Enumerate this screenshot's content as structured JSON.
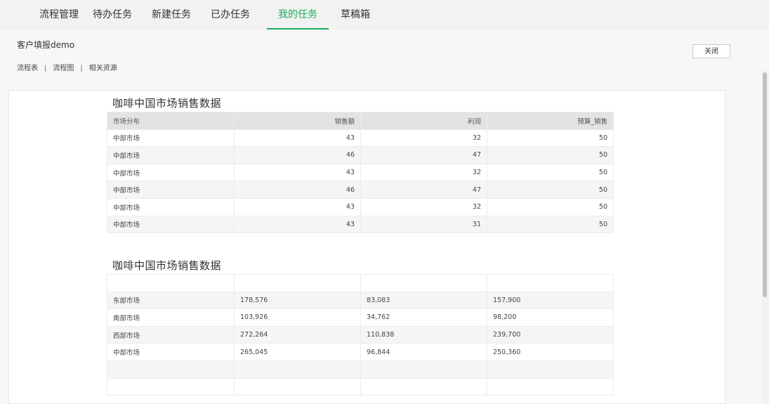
{
  "tabs": [
    {
      "label": "流程管理",
      "active": false
    },
    {
      "label": "待办任务",
      "active": false
    },
    {
      "label": "新建任务",
      "active": false
    },
    {
      "label": "已办任务",
      "active": false
    },
    {
      "label": "我的任务",
      "active": true
    },
    {
      "label": "草稿箱",
      "active": false
    }
  ],
  "accent_color": "#1aad5b",
  "header": {
    "form_title": "客户填报demo",
    "subnav": [
      "流程表",
      "流程图",
      "相关资源"
    ],
    "separator": "|",
    "close_label": "关闭"
  },
  "report1": {
    "title": "咖啡中国市场销售数据",
    "columns": [
      "市场分布",
      "销售额",
      "利润",
      "预算_销售"
    ],
    "rows": [
      [
        "中部市场",
        "43",
        "32",
        "50"
      ],
      [
        "中部市场",
        "46",
        "47",
        "50"
      ],
      [
        "中部市场",
        "43",
        "32",
        "50"
      ],
      [
        "中部市场",
        "46",
        "47",
        "50"
      ],
      [
        "中部市场",
        "43",
        "32",
        "50"
      ],
      [
        "中部市场",
        "43",
        "31",
        "50"
      ]
    ]
  },
  "report2": {
    "title": "咖啡中国市场销售数据",
    "rows": [
      [
        "",
        "",
        "",
        ""
      ],
      [
        "东部市场",
        "178,576",
        "83,083",
        "157,900"
      ],
      [
        "南部市场",
        "103,926",
        "34,762",
        "98,200"
      ],
      [
        "西部市场",
        "272,264",
        "110,838",
        "239,700"
      ],
      [
        "中部市场",
        "265,045",
        "96,844",
        "250,360"
      ],
      [
        "",
        "",
        "",
        ""
      ],
      [
        "",
        "",
        "",
        ""
      ]
    ]
  }
}
